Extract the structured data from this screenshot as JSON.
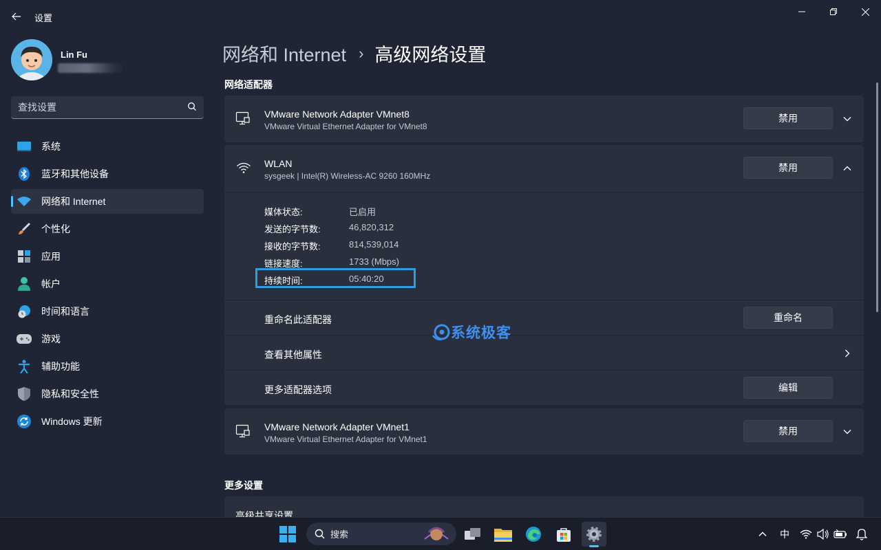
{
  "window": {
    "title": "设置"
  },
  "profile": {
    "name": "Lin Fu"
  },
  "search": {
    "placeholder": "查找设置"
  },
  "sidebar": {
    "items": [
      {
        "label": "系统",
        "icon": "system-icon"
      },
      {
        "label": "蓝牙和其他设备",
        "icon": "bluetooth-icon"
      },
      {
        "label": "网络和 Internet",
        "icon": "wifi-icon",
        "active": true
      },
      {
        "label": "个性化",
        "icon": "brush-icon"
      },
      {
        "label": "应用",
        "icon": "apps-icon"
      },
      {
        "label": "帐户",
        "icon": "account-icon"
      },
      {
        "label": "时间和语言",
        "icon": "time-language-icon"
      },
      {
        "label": "游戏",
        "icon": "gamepad-icon"
      },
      {
        "label": "辅助功能",
        "icon": "accessibility-icon"
      },
      {
        "label": "隐私和安全性",
        "icon": "shield-icon"
      },
      {
        "label": "Windows 更新",
        "icon": "update-icon"
      }
    ]
  },
  "breadcrumb": {
    "parent": "网络和 Internet",
    "separator": "›",
    "current": "高级网络设置"
  },
  "sections": {
    "adapters": "网络适配器",
    "more": "更多设置"
  },
  "adapters": [
    {
      "name": "VMware Network Adapter VMnet8",
      "desc": "VMware Virtual Ethernet Adapter for VMnet8",
      "button": "禁用",
      "icon": "ethernet-icon",
      "expanded": false
    },
    {
      "name": "WLAN",
      "desc": "sysgeek | Intel(R) Wireless-AC 9260 160MHz",
      "button": "禁用",
      "icon": "wifi-icon",
      "expanded": true
    },
    {
      "name": "VMware Network Adapter VMnet1",
      "desc": "VMware Virtual Ethernet Adapter for VMnet1",
      "button": "禁用",
      "icon": "ethernet-icon",
      "expanded": false
    }
  ],
  "wlan_props": [
    {
      "label": "媒体状态:",
      "value": "已启用"
    },
    {
      "label": "发送的字节数:",
      "value": "46,820,312"
    },
    {
      "label": "接收的字节数:",
      "value": "814,539,014"
    },
    {
      "label": "链接速度:",
      "value": "1733 (Mbps)"
    },
    {
      "label": "持续时间:",
      "value": "05:40:20"
    }
  ],
  "wlan_actions": {
    "rename_label": "重命名此适配器",
    "rename_button": "重命名",
    "more_props_label": "查看其他属性",
    "more_options_label": "更多适配器选项",
    "edit_button": "编辑"
  },
  "more_settings": {
    "first_item": "高级共享设置"
  },
  "watermark": {
    "text": "系统极客"
  },
  "taskbar": {
    "search_label": "搜索",
    "ime": "中"
  },
  "colors": {
    "accent": "#4cc2ff",
    "highlight": "#2d9fe0",
    "background": "#1f2535",
    "card": "#2a2f3e"
  }
}
